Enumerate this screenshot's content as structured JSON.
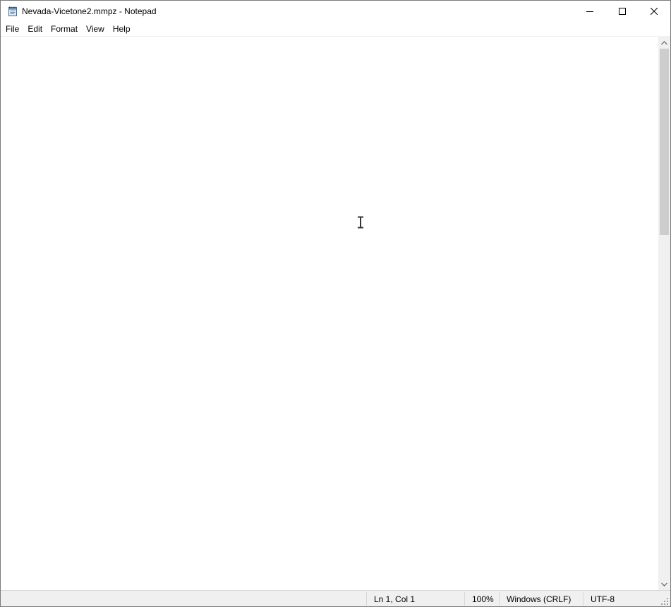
{
  "window": {
    "title": "Nevada-Vicetone2.mmpz - Notepad",
    "app_icon": "notepad-icon",
    "controls": {
      "minimize": "minimize-icon",
      "maximize": "maximize-icon",
      "close": "close-icon"
    }
  },
  "menubar": {
    "items": [
      {
        "label": "File"
      },
      {
        "label": "Edit"
      },
      {
        "label": "Format"
      },
      {
        "label": "View"
      },
      {
        "label": "Help"
      }
    ]
  },
  "editor": {
    "content": "",
    "cursor_icon": "text-cursor-icon"
  },
  "scrollbar": {
    "up_icon": "scroll-up-arrow-icon",
    "down_icon": "scroll-down-arrow-icon"
  },
  "statusbar": {
    "position": "Ln 1, Col 1",
    "zoom": "100%",
    "line_ending": "Windows (CRLF)",
    "encoding": "UTF-8",
    "grip_icon": "resize-grip-icon"
  },
  "colors": {
    "window_bg": "#ffffff",
    "statusbar_bg": "#f0f0f0",
    "scrollbar_track": "#f0f0f0",
    "scrollbar_thumb": "#cdcdcd",
    "border": "#7a7a7a"
  }
}
